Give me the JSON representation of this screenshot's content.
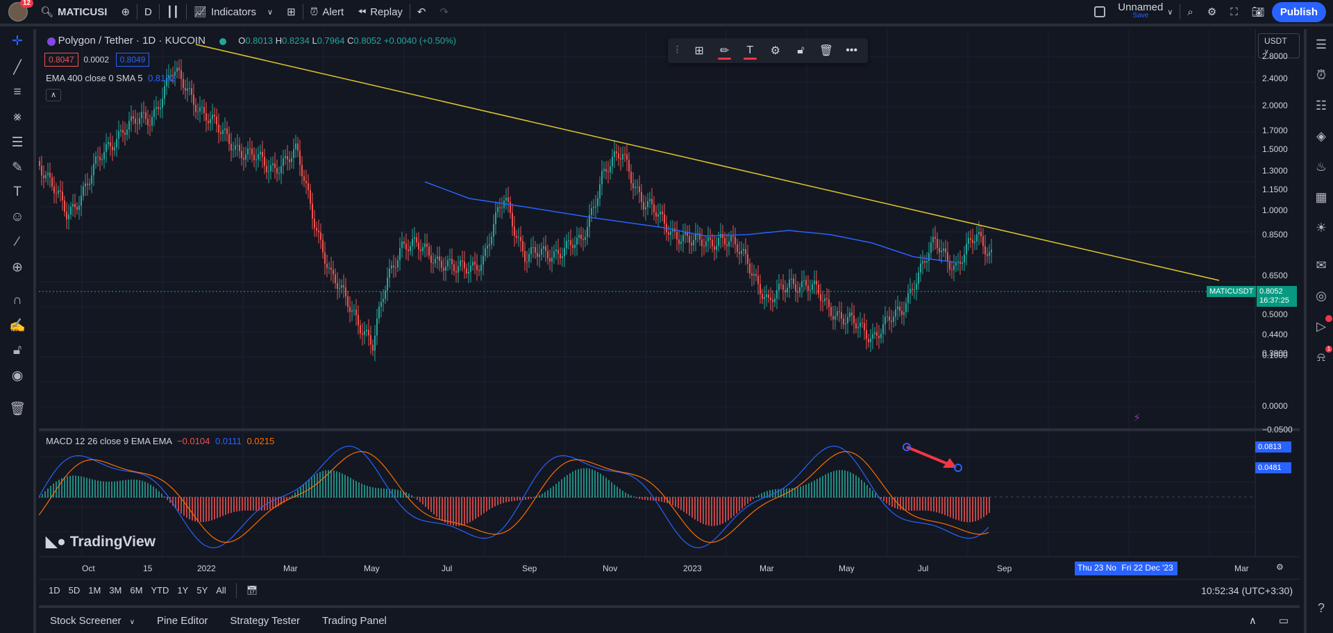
{
  "topbar": {
    "notifications": "12",
    "symbol": "MATICUSI",
    "interval": "D",
    "indicators": "Indicators",
    "alert": "Alert",
    "replay": "Replay",
    "layout_name": "Unnamed",
    "layout_save": "Save",
    "publish": "Publish"
  },
  "legend": {
    "title": "Polygon / Tether · 1D · KUCOIN",
    "o_label": "O",
    "o": "0.8013",
    "h_label": "H",
    "h": "0.8234",
    "l_label": "L",
    "l": "0.7964",
    "c_label": "C",
    "c": "0.8052",
    "change": "+0.0040 (+0.50%)",
    "bid": "0.8047",
    "spread": "0.0002",
    "ask": "0.8049",
    "ema_label": "EMA 400 close 0 SMA 5",
    "ema_value": "0.8192",
    "macd_label": "MACD 12 26 close 9 EMA EMA",
    "macd_hist": "−0.0104",
    "macd_line": "0.0111",
    "macd_signal": "0.0215"
  },
  "price_axis": {
    "currency": "USDT",
    "ticks": [
      "2.8000",
      "2.4000",
      "2.0000",
      "1.7000",
      "1.5000",
      "1.3000",
      "1.1500",
      "1.0000",
      "0.8500",
      "0.6500",
      "0.5700",
      "0.5000",
      "0.4400",
      "0.3900"
    ],
    "last_symbol": "MATICUSDT",
    "last_price": "0.8052",
    "countdown": "16:37:25"
  },
  "macd_axis": {
    "ticks": [
      "0.1000",
      "0.0000",
      "−0.0500"
    ],
    "tag_top": "0.0813",
    "tag_bottom": "0.0481"
  },
  "time_axis": {
    "ticks": [
      "Oct",
      "15",
      "2022",
      "Mar",
      "May",
      "Jul",
      "Sep",
      "Nov",
      "2023",
      "Mar",
      "May",
      "Jul",
      "Sep",
      "Mar"
    ],
    "range_start": "Thu 23 No",
    "range_end": "Fri 22 Dec '23"
  },
  "watermark": "TradingView",
  "ranges": [
    "1D",
    "5D",
    "1M",
    "3M",
    "6M",
    "YTD",
    "1Y",
    "5Y",
    "All"
  ],
  "clock": "10:52:34 (UTC+3:30)",
  "bottom_tabs": [
    "Stock Screener",
    "Pine Editor",
    "Strategy Tester",
    "Trading Panel"
  ],
  "right_badges": {
    "notifications": "1"
  },
  "colors": {
    "background": "#131722",
    "up": "#26a69a",
    "down": "#ef5350",
    "ema": "#2962ff",
    "trendline": "#e3c92b",
    "macd_line": "#2962ff",
    "signal_line": "#ff6d00",
    "accent": "#2962ff"
  },
  "icons": {
    "left": [
      "crosshair-icon",
      "trendline-icon",
      "fib-icon",
      "pattern-icon",
      "prediction-icon",
      "brush-icon",
      "text-icon",
      "emoji-icon",
      "ruler-icon",
      "zoom-icon",
      "magnet-icon",
      "lock-drawing-icon",
      "lock-icon",
      "eye-icon",
      "trash-icon"
    ],
    "right": [
      "watchlist-icon",
      "alerts-icon",
      "news-icon",
      "layers-icon",
      "hotlist-icon",
      "calendar-icon",
      "ideas-icon",
      "chat-icon",
      "streams-icon",
      "replay-icon",
      "notifications-icon"
    ]
  }
}
